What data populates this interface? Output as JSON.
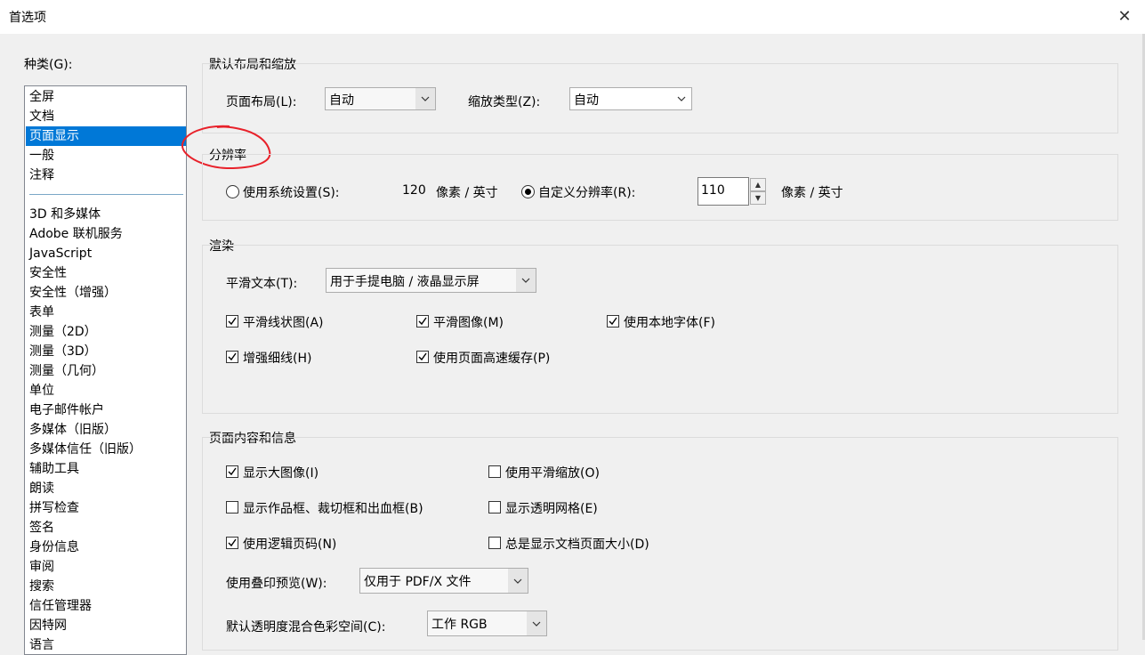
{
  "window": {
    "title": "首选项",
    "close_glyph": "✕"
  },
  "categories": {
    "label": "种类(G):",
    "top_items": [
      "全屏",
      "文档",
      "页面显示",
      "一般",
      "注释"
    ],
    "selected": "页面显示",
    "items": [
      "3D 和多媒体",
      "Adobe 联机服务",
      "JavaScript",
      "安全性",
      "安全性（增强）",
      "表单",
      "测量（2D）",
      "测量（3D）",
      "测量（几何）",
      "单位",
      "电子邮件帐户",
      "多媒体（旧版）",
      "多媒体信任（旧版）",
      "辅助工具",
      "朗读",
      "拼写检查",
      "签名",
      "身份信息",
      "审阅",
      "搜索",
      "信任管理器",
      "因特网",
      "语言"
    ]
  },
  "layout_group": {
    "title": "默认布局和缩放",
    "page_layout_label": "页面布局(L):",
    "page_layout_value": "自动",
    "zoom_label": "缩放类型(Z):",
    "zoom_value": "自动"
  },
  "resolution": {
    "title": "分辨率",
    "system_label": "使用系统设置(S):",
    "system_value": "120",
    "unit": "像素 / 英寸",
    "custom_label": "自定义分辨率(R):",
    "custom_value": "110",
    "selected": "custom",
    "annotation_color": "#e8212a"
  },
  "rendering": {
    "title": "渲染",
    "smooth_text_label": "平滑文本(T):",
    "smooth_text_value": "用于手提电脑 / 液晶显示屏",
    "checkboxes": [
      {
        "label": "平滑线状图(A)",
        "checked": true
      },
      {
        "label": "平滑图像(M)",
        "checked": true
      },
      {
        "label": "使用本地字体(F)",
        "checked": true
      },
      {
        "label": "增强细线(H)",
        "checked": true
      },
      {
        "label": "使用页面高速缓存(P)",
        "checked": true
      }
    ]
  },
  "content": {
    "title": "页面内容和信息",
    "checkboxes": [
      {
        "label": "显示大图像(I)",
        "checked": true
      },
      {
        "label": "使用平滑缩放(O)",
        "checked": false
      },
      {
        "label": "显示作品框、裁切框和出血框(B)",
        "checked": false
      },
      {
        "label": "显示透明网格(E)",
        "checked": false
      },
      {
        "label": "使用逻辑页码(N)",
        "checked": true
      },
      {
        "label": "总是显示文档页面大小(D)",
        "checked": false
      }
    ],
    "overprint_label": "使用叠印预览(W):",
    "overprint_value": "仅用于 PDF/X 文件",
    "blend_label": "默认透明度混合色彩空间(C):",
    "blend_value": "工作 RGB"
  }
}
